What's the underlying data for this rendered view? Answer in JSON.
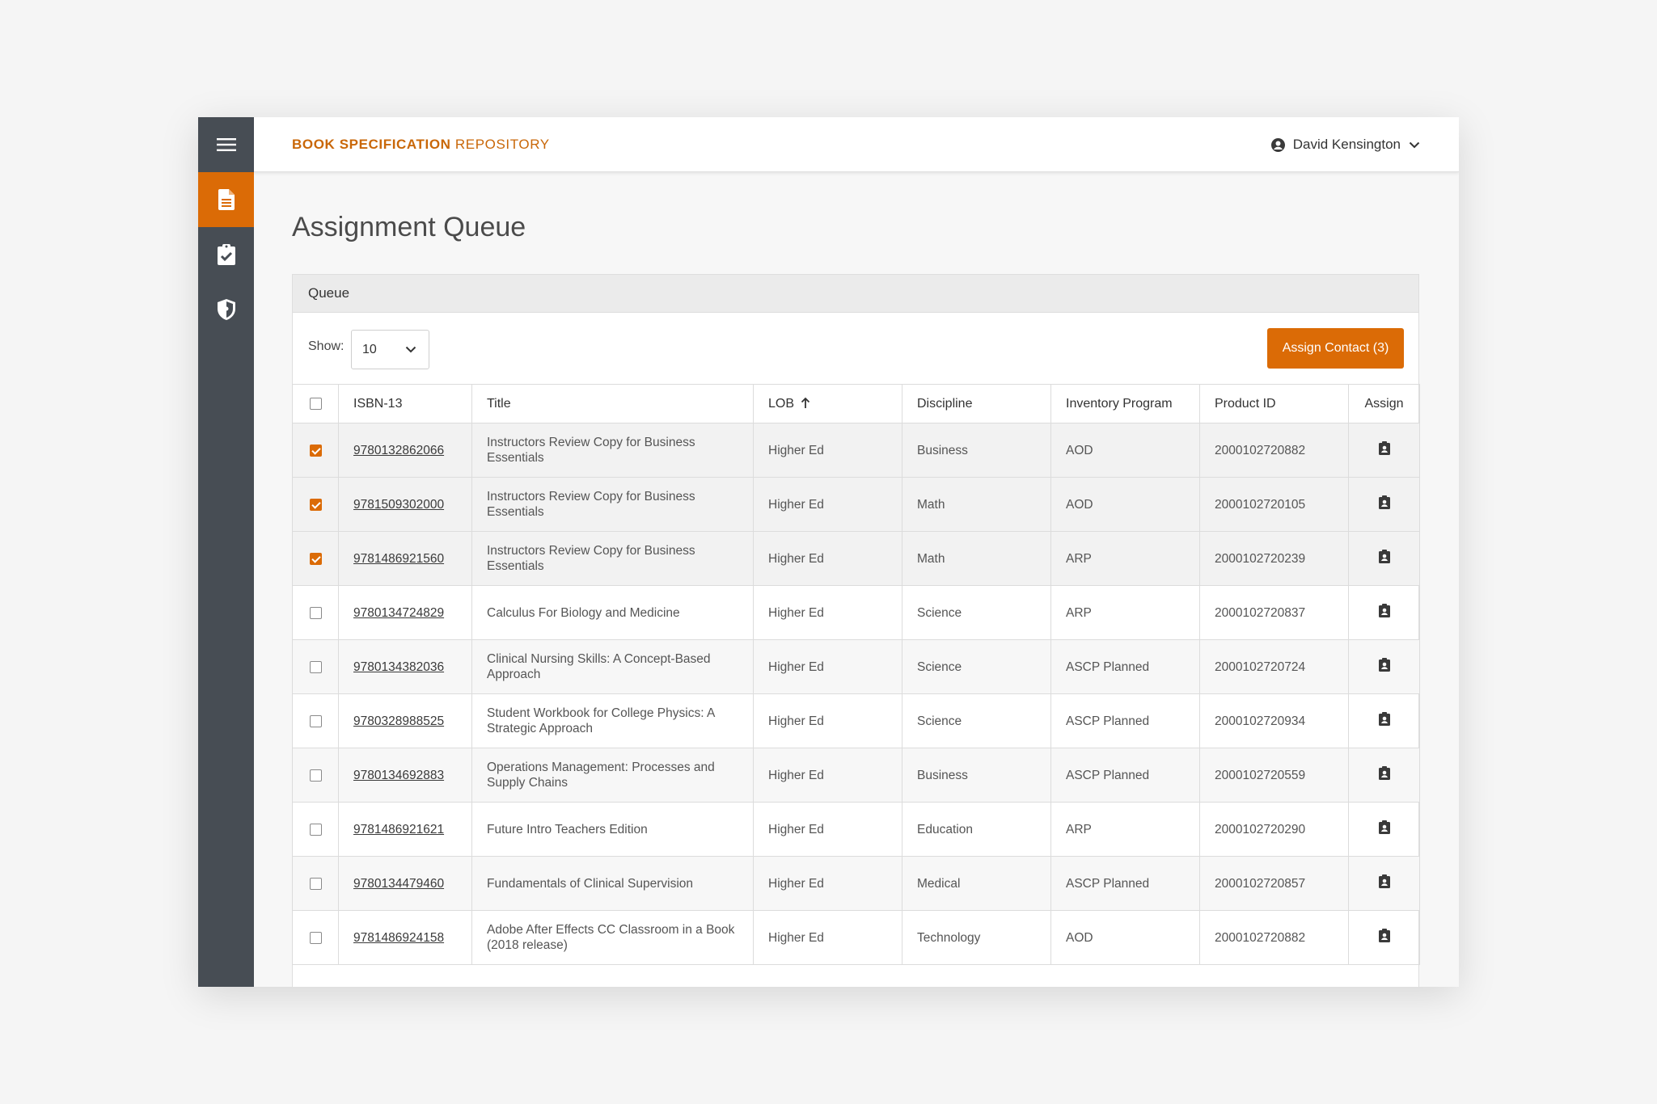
{
  "app": {
    "brand_bold": "BOOK SPECIFICATION",
    "brand_light": "REPOSITORY",
    "user_name": "David Kensington",
    "accent_color": "#db6b06",
    "sidebar_color": "#474d54"
  },
  "sidebar": {
    "items": [
      {
        "icon": "hamburger-menu-icon",
        "active": false
      },
      {
        "icon": "document-icon",
        "active": true
      },
      {
        "icon": "clipboard-check-icon",
        "active": false
      },
      {
        "icon": "shield-icon",
        "active": false
      }
    ]
  },
  "page": {
    "title": "Assignment Queue"
  },
  "queue": {
    "card_title": "Queue",
    "show_label": "Show:",
    "page_size": "10",
    "assign_button": "Assign Contact (3)",
    "columns": [
      "ISBN-13",
      "Title",
      "LOB",
      "Discipline",
      "Inventory Program",
      "Product ID",
      "Assign"
    ],
    "sorted_column": "LOB",
    "sort_direction": "ascending",
    "rows": [
      {
        "selected": true,
        "isbn": "9780132862066",
        "title": "Instructors Review Copy for Business Essentials",
        "lob": "Higher Ed",
        "discipline": "Business",
        "inventory": "AOD",
        "product_id": "2000102720882"
      },
      {
        "selected": true,
        "isbn": "9781509302000",
        "title": "Instructors Review Copy for Business Essentials",
        "lob": "Higher Ed",
        "discipline": "Math",
        "inventory": "AOD",
        "product_id": "2000102720105"
      },
      {
        "selected": true,
        "isbn": "9781486921560",
        "title": "Instructors Review Copy for Business Essentials",
        "lob": "Higher Ed",
        "discipline": "Math",
        "inventory": "ARP",
        "product_id": "2000102720239"
      },
      {
        "selected": false,
        "isbn": "9780134724829",
        "title": "Calculus For Biology and Medicine",
        "lob": "Higher Ed",
        "discipline": "Science",
        "inventory": "ARP",
        "product_id": "2000102720837"
      },
      {
        "selected": false,
        "isbn": "9780134382036",
        "title": "Clinical Nursing Skills: A Concept-Based Approach",
        "lob": "Higher Ed",
        "discipline": "Science",
        "inventory": "ASCP Planned",
        "product_id": "2000102720724"
      },
      {
        "selected": false,
        "isbn": "9780328988525",
        "title": "Student Workbook for College Physics: A Strategic Approach",
        "lob": "Higher Ed",
        "discipline": "Science",
        "inventory": "ASCP Planned",
        "product_id": "2000102720934"
      },
      {
        "selected": false,
        "isbn": "9780134692883",
        "title": "Operations Management: Processes and Supply Chains",
        "lob": "Higher Ed",
        "discipline": "Business",
        "inventory": "ASCP Planned",
        "product_id": "2000102720559"
      },
      {
        "selected": false,
        "isbn": "9781486921621",
        "title": "Future Intro Teachers Edition",
        "lob": "Higher Ed",
        "discipline": "Education",
        "inventory": "ARP",
        "product_id": "2000102720290"
      },
      {
        "selected": false,
        "isbn": "9780134479460",
        "title": "Fundamentals of Clinical Supervision",
        "lob": "Higher Ed",
        "discipline": "Medical",
        "inventory": "ASCP Planned",
        "product_id": "2000102720857"
      },
      {
        "selected": false,
        "isbn": "9781486924158",
        "title": "Adobe After Effects CC Classroom in a Book (2018 release)",
        "lob": "Higher Ed",
        "discipline": "Technology",
        "inventory": "AOD",
        "product_id": "2000102720882"
      }
    ]
  }
}
